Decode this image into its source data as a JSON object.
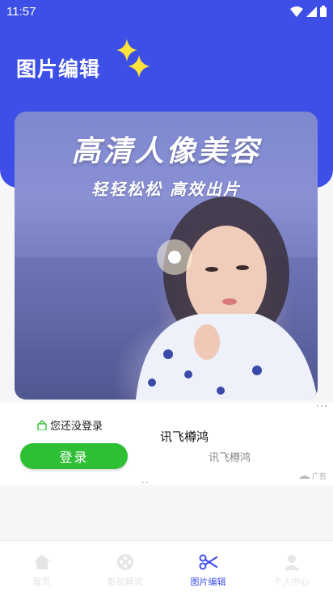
{
  "status_bar": {
    "time": "11:57"
  },
  "header": {
    "title": "图片编辑"
  },
  "banner": {
    "headline": "高清人像美容",
    "subline": "轻轻松松  高效出片"
  },
  "ad": {
    "login_hint": "您还没登录",
    "login_button": "登录",
    "title": "讯飞樽鸿",
    "subtitle": "讯飞樽鸿",
    "badge": "广告",
    "more": "···"
  },
  "nav": {
    "items": [
      {
        "label": "首页",
        "icon": "home-icon"
      },
      {
        "label": "影视解说",
        "icon": "film-reel-icon"
      },
      {
        "label": "图片编辑",
        "icon": "scissors-icon"
      },
      {
        "label": "个人中心",
        "icon": "person-icon"
      }
    ],
    "active_index": 2
  },
  "colors": {
    "primary": "#3d4fe6",
    "login_green": "#2fbf35"
  }
}
